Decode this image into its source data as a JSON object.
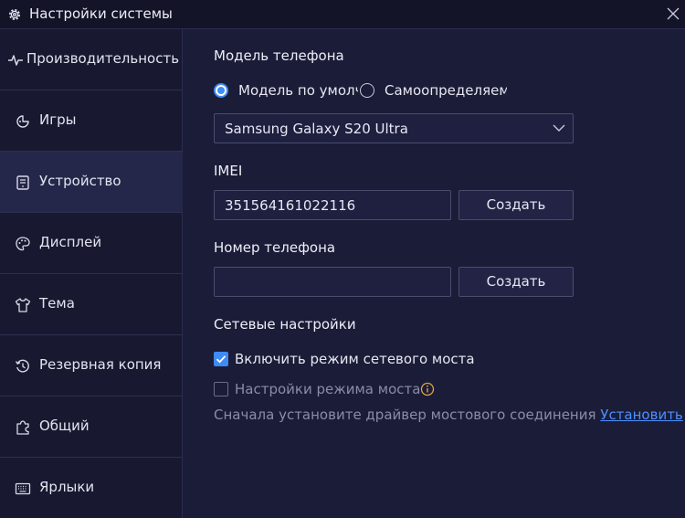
{
  "window": {
    "title": "Настройки системы",
    "accent_color": "#3e8bf5",
    "link_color": "#4c8fff"
  },
  "sidebar": {
    "items": [
      {
        "label": "Производительность",
        "icon": "pulse-icon",
        "active": false
      },
      {
        "label": "Игры",
        "icon": "gamepad-icon",
        "active": false
      },
      {
        "label": "Устройство",
        "icon": "device-icon",
        "active": true
      },
      {
        "label": "Дисплей",
        "icon": "palette-icon",
        "active": false
      },
      {
        "label": "Тема",
        "icon": "shirt-icon",
        "active": false
      },
      {
        "label": "Резервная копия",
        "icon": "history-icon",
        "active": false
      },
      {
        "label": "Общий",
        "icon": "puzzle-icon",
        "active": false
      },
      {
        "label": "Ярлыки",
        "icon": "keyboard-icon",
        "active": false
      }
    ]
  },
  "phone_model": {
    "title": "Модель телефона",
    "radio_default": {
      "label": "Модель по умолч",
      "checked": true
    },
    "radio_custom": {
      "label": "Самоопределяемі",
      "checked": false
    },
    "selected_model": "Samsung Galaxy S20 Ultra"
  },
  "imei": {
    "title": "IMEI",
    "value": "351564161022116",
    "button": "Создать"
  },
  "phone_number": {
    "title": "Номер телефона",
    "value": "",
    "button": "Создать"
  },
  "network": {
    "title": "Сетевые настройки",
    "bridge_mode": {
      "label": "Включить режим сетевого моста",
      "checked": true
    },
    "bridge_settings": {
      "label": "Настройки режима моста",
      "checked": false,
      "disabled": true
    },
    "driver_note": "Сначала установите драйвер мостового соединения",
    "driver_link": "Установить"
  }
}
